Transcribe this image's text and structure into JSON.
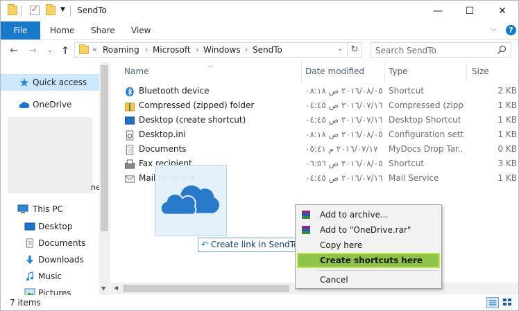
{
  "window": {
    "title": "SendTo",
    "controls": {
      "minimize": "—",
      "maximize": "☐",
      "close": "✕"
    }
  },
  "ribbon": {
    "tabs": [
      "File",
      "Home",
      "Share",
      "View"
    ],
    "help_label": "?",
    "expand_label": "⌵"
  },
  "address": {
    "overflow": "«",
    "crumbs": [
      "Roaming",
      "Microsoft",
      "Windows",
      "SendTo"
    ],
    "separator": "›"
  },
  "search": {
    "placeholder": "Search SendTo"
  },
  "nav": {
    "quick_access": "Quick access",
    "onedrive": "OneDrive",
    "this_pc": "This PC",
    "desktop": "Desktop",
    "documents": "Documents",
    "downloads": "Downloads",
    "music": "Music",
    "pictures": "Pictures",
    "partial_letter": "ne"
  },
  "columns": {
    "name": "Name",
    "date": "Date modified",
    "type": "Type",
    "size": "Size"
  },
  "files": [
    {
      "name": "Bluetooth device",
      "date": "٢٠١٦/٠٨/٠٥ ص ٠٨:١٨",
      "type": "Shortcut",
      "size": "2 KB"
    },
    {
      "name": "Compressed (zipped) folder",
      "date": "٢٠١٦/٠٧/١٦ ص ٠٤:٤٥",
      "type": "Compressed (zipp...",
      "size": "1 KB"
    },
    {
      "name": "Desktop (create shortcut)",
      "date": "٢٠١٦/٠٧/١٦ ص ٠٤:٤٥",
      "type": "Desktop Shortcut",
      "size": "1 KB"
    },
    {
      "name": "Desktop.ini",
      "date": "٢٠١٦/٠٨/٠٥ ص ٠٨:١٨",
      "type": "Configuration sett...",
      "size": "1 KB"
    },
    {
      "name": "Documents",
      "date": "٢٠١٦/٠٧/١٧ م ٠٥:٤١",
      "type": "MyDocs Drop Tar...",
      "size": "0 KB"
    },
    {
      "name": "Fax recipient",
      "date": "٢٠١٦/٠٨/٠٥ ص ٠٦:٥٦",
      "type": "Shortcut",
      "size": "3 KB"
    },
    {
      "name": "Mail recipient",
      "date": "٢٠١٦/٠٧/١٦ ص ٠٤:٤٥",
      "type": "Mail Service",
      "size": "1 KB"
    }
  ],
  "drag": {
    "tooltip": "Create link in SendTo"
  },
  "context_menu": [
    {
      "label": "Add to archive..."
    },
    {
      "label": "Add to \"OneDrive.rar\""
    },
    {
      "label": "Copy here"
    },
    {
      "label": "Create shortcuts here"
    },
    {
      "label": "Cancel"
    }
  ],
  "status": {
    "items": "7 items"
  },
  "colors": {
    "accent": "#1979ca",
    "selection": "#cce8ff",
    "highlight": "#8ec34a",
    "cloud": "#1e73c8"
  },
  "icons": {
    "qa": [
      "folder-icon",
      "properties-icon",
      "new-folder-icon"
    ],
    "nav": [
      "back-arrow-icon",
      "forward-arrow-icon",
      "recent-dropdown-icon",
      "up-arrow-icon"
    ],
    "files": [
      "bluetooth-icon",
      "zip-folder-icon",
      "desktop-icon",
      "ini-file-icon",
      "documents-icon",
      "fax-icon",
      "mail-icon"
    ]
  }
}
